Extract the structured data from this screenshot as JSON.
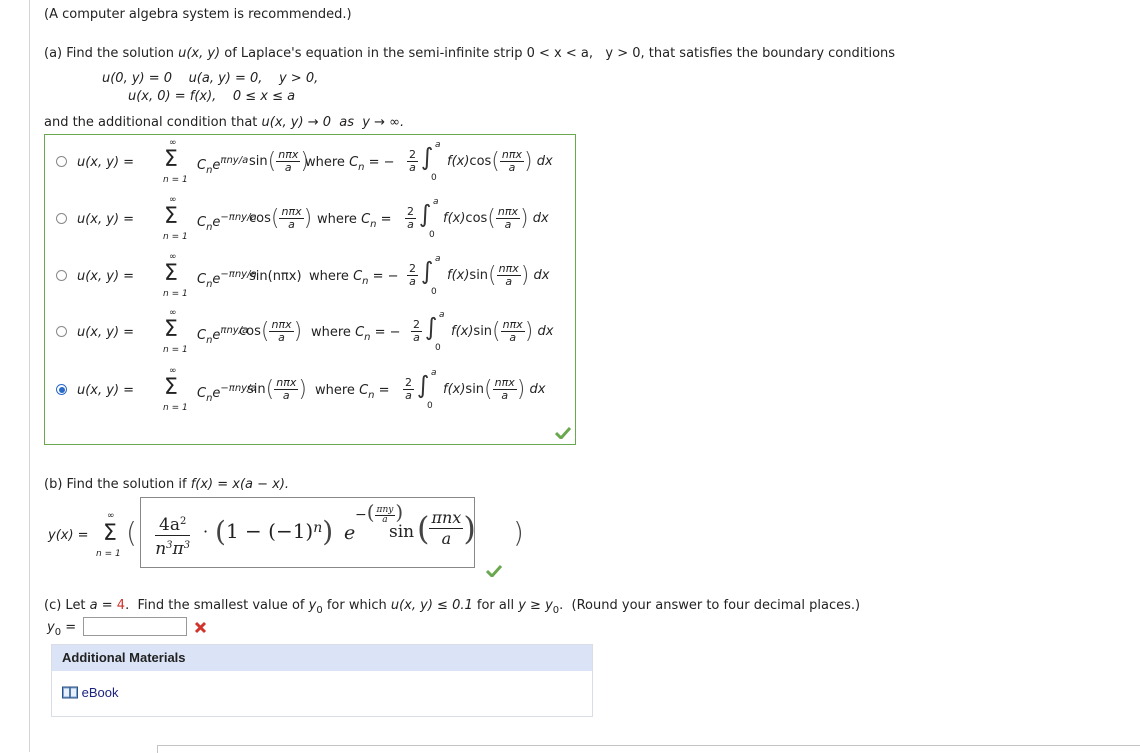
{
  "intro": "(A computer algebra system is recommended.)",
  "part_a": {
    "prompt_prefix": "(a) Find the solution ",
    "prompt_uxy": "u(x, y)",
    "prompt_middle": " of Laplace's equation in the semi-infinite strip ",
    "prompt_strip": "0 < x < a,   y > 0,",
    "prompt_suffix": " that satisfies the boundary conditions",
    "bc_line1": "u(0, y) = 0    u(a, y) = 0,    y > 0,",
    "bc_line2": "u(x, 0) = f(x),    0 ≤ x ≤ a",
    "additional_prefix": "and the additional condition that ",
    "additional_math": "u(x, y) → 0  as  y → ∞.",
    "choices": [
      {
        "lhs": "u(x, y) =",
        "sum_top": "∞",
        "sum_bottom": "n = 1",
        "coef": "C",
        "coef_sub": "n",
        "exp_base": "e",
        "exponent": "πny/a",
        "trig": "sin",
        "trig_arg_num": "nπx",
        "trig_arg_den": "a",
        "trig_plain": "",
        "where": "where",
        "cn": "C",
        "cn_sub": "n",
        "eq": "= −",
        "frac_num": "2",
        "frac_den": "a",
        "int_top": "a",
        "int_bottom": "0",
        "integrand_f": "f(x)",
        "integrand_trig": "cos",
        "int_arg_num": "nπx",
        "int_arg_den": "a",
        "dx": "dx",
        "selected": false
      },
      {
        "lhs": "u(x, y) =",
        "sum_top": "∞",
        "sum_bottom": "n = 1",
        "coef": "C",
        "coef_sub": "n",
        "exp_base": "e",
        "exponent": "−πny/a",
        "trig": "cos",
        "trig_arg_num": "nπx",
        "trig_arg_den": "a",
        "trig_plain": "",
        "where": "where",
        "cn": "C",
        "cn_sub": "n",
        "eq": "=",
        "frac_num": "2",
        "frac_den": "a",
        "int_top": "a",
        "int_bottom": "0",
        "integrand_f": "f(x)",
        "integrand_trig": "cos",
        "int_arg_num": "nπx",
        "int_arg_den": "a",
        "dx": "dx",
        "selected": false
      },
      {
        "lhs": "u(x, y) =",
        "sum_top": "∞",
        "sum_bottom": "n = 1",
        "coef": "C",
        "coef_sub": "n",
        "exp_base": "e",
        "exponent": "−πny/a",
        "trig": "",
        "trig_arg_num": "",
        "trig_arg_den": "",
        "trig_plain": "sin(nπx)",
        "where": "where",
        "cn": "C",
        "cn_sub": "n",
        "eq": "= −",
        "frac_num": "2",
        "frac_den": "a",
        "int_top": "a",
        "int_bottom": "0",
        "integrand_f": "f(x)",
        "integrand_trig": "sin",
        "int_arg_num": "nπx",
        "int_arg_den": "a",
        "dx": "dx",
        "selected": false
      },
      {
        "lhs": "u(x, y) =",
        "sum_top": "∞",
        "sum_bottom": "n = 1",
        "coef": "C",
        "coef_sub": "n",
        "exp_base": "e",
        "exponent": "πny/a",
        "trig": "cos",
        "trig_arg_num": "nπx",
        "trig_arg_den": "a",
        "trig_plain": "",
        "where": "where",
        "cn": "C",
        "cn_sub": "n",
        "eq": "= −",
        "frac_num": "2",
        "frac_den": "a",
        "int_top": "a",
        "int_bottom": "0",
        "integrand_f": "f(x)",
        "integrand_trig": "sin",
        "int_arg_num": "nπx",
        "int_arg_den": "a",
        "dx": "dx",
        "selected": false
      },
      {
        "lhs": "u(x, y) =",
        "sum_top": "∞",
        "sum_bottom": "n = 1",
        "coef": "C",
        "coef_sub": "n",
        "exp_base": "e",
        "exponent": "−πny/a",
        "trig": "sin",
        "trig_arg_num": "nπx",
        "trig_arg_den": "a",
        "trig_plain": "",
        "where": "where",
        "cn": "C",
        "cn_sub": "n",
        "eq": "=",
        "frac_num": "2",
        "frac_den": "a",
        "int_top": "a",
        "int_bottom": "0",
        "integrand_f": "f(x)",
        "integrand_trig": "sin",
        "int_arg_num": "nπx",
        "int_arg_den": "a",
        "dx": "dx",
        "selected": true
      }
    ],
    "status": "correct"
  },
  "part_b": {
    "prompt_prefix": "(b) Find the solution if ",
    "prompt_math": "f(x) = x(a − x).",
    "lhs": "y(x) =",
    "sum_top": "∞",
    "sum_bottom": "n = 1",
    "open_paren": "(",
    "close_paren": ")",
    "answer": {
      "frac_num": "4a",
      "frac_num_sup": "2",
      "frac_den_n": "n",
      "frac_den_n_sup": "3",
      "frac_den_pi": "π",
      "frac_den_pi_sup": "3",
      "dot": "·",
      "paren_expr": "1 − (−1)",
      "paren_expr_sup": "n",
      "e": "e",
      "exp_sign": "−",
      "exp_num": "πny",
      "exp_den": "a",
      "sin": "sin",
      "sin_num": "πnx",
      "sin_den": "a"
    },
    "status": "correct"
  },
  "part_c": {
    "prompt_prefix": "(c) Let ",
    "a_label": "a = ",
    "a_value": "4",
    "prompt_mid1": ".  Find the smallest value of ",
    "y0": "y",
    "y0_sub": "0",
    "prompt_mid2": " for which ",
    "condition": "u(x, y) ≤ 0.1",
    "prompt_mid3": " for all ",
    "cond2": "y ≥ y",
    "cond2_sub": "0",
    "prompt_suffix": ".  (Round your answer to four decimal places.)",
    "input_label": "y",
    "input_label_sub": "0",
    "input_eq": " =",
    "input_value": "",
    "status": "incorrect"
  },
  "additional_materials": {
    "title": "Additional Materials",
    "links": [
      {
        "label": "eBook",
        "icon": "book-icon"
      }
    ]
  },
  "colors": {
    "correct": "#6aa84f",
    "incorrect": "#d0342c",
    "header_bg": "#dbe4f7",
    "radio_selected": "#2a6ac9"
  }
}
